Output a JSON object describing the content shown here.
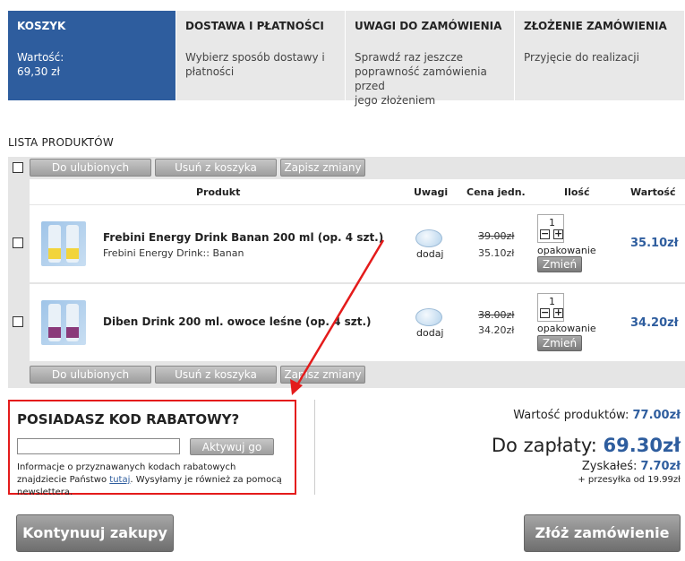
{
  "steps": [
    {
      "title": "KOSZYK",
      "desc_line1": "Wartość:",
      "desc_line2": "69,30 zł"
    },
    {
      "title": "DOSTAWA I PŁATNOŚCI",
      "desc_line1": "Wybierz sposób dostawy i",
      "desc_line2": "płatności"
    },
    {
      "title": "UWAGI DO ZAMÓWIENIA",
      "desc_line1": "Sprawdź raz jeszcze",
      "desc_line2": "poprawność zamówienia przed",
      "desc_line3": "jego złożeniem"
    },
    {
      "title": "ZŁOŻENIE ZAMÓWIENIA",
      "desc_line1": "Przyjęcie do realizacji"
    }
  ],
  "list": {
    "title": "LISTA PRODUKTÓW",
    "buttons": {
      "favorites": "Do ulubionych",
      "remove": "Usuń z koszyka",
      "save": "Zapisz zmiany"
    },
    "headers": {
      "product": "Produkt",
      "notes": "Uwagi",
      "unit_price": "Cena jedn.",
      "qty": "Ilość",
      "value": "Wartość"
    },
    "items": [
      {
        "name": "Frebini Energy Drink Banan 200 ml (op. 4 szt.)",
        "subtitle": "Frebini Energy Drink:: Banan",
        "note": "dodaj",
        "old_price": "39.00zł",
        "price": "35.10zł",
        "qty": "1",
        "unit": "opakowanie",
        "change": "Zmień",
        "total": "35.10zł",
        "label_color": "#f2d43c"
      },
      {
        "name": "Diben Drink 200 ml. owoce leśne (op. 4 szt.)",
        "subtitle": "",
        "note": "dodaj",
        "old_price": "38.00zł",
        "price": "34.20zł",
        "qty": "1",
        "unit": "opakowanie",
        "change": "Zmień",
        "total": "34.20zł",
        "label_color": "#8a3a7a"
      }
    ]
  },
  "promo": {
    "title": "POSIADASZ KOD RABATOWY?",
    "input_value": "",
    "button": "Aktywuj go",
    "info_before_link": "Informacje o przyznawanych kodach rabatowych znajdziecie Państwo",
    "link": "tutaj",
    "info_after_link": ". Wysyłamy je również za pomocą newslettera."
  },
  "summary": {
    "products_label": "Wartość produktów:",
    "products_value": "77.00zł",
    "pay_label": "Do zapłaty:",
    "pay_value": "69.30zł",
    "saved_label": "Zyskałeś:",
    "saved_value": "7.70zł",
    "shipping": "+ przesyłka od 19.99zł"
  },
  "actions": {
    "continue": "Kontynuuj zakupy",
    "order": "Złóż zamówienie"
  },
  "colors": {
    "accent": "#2e5d9e",
    "highlight": "#e41b1b"
  }
}
